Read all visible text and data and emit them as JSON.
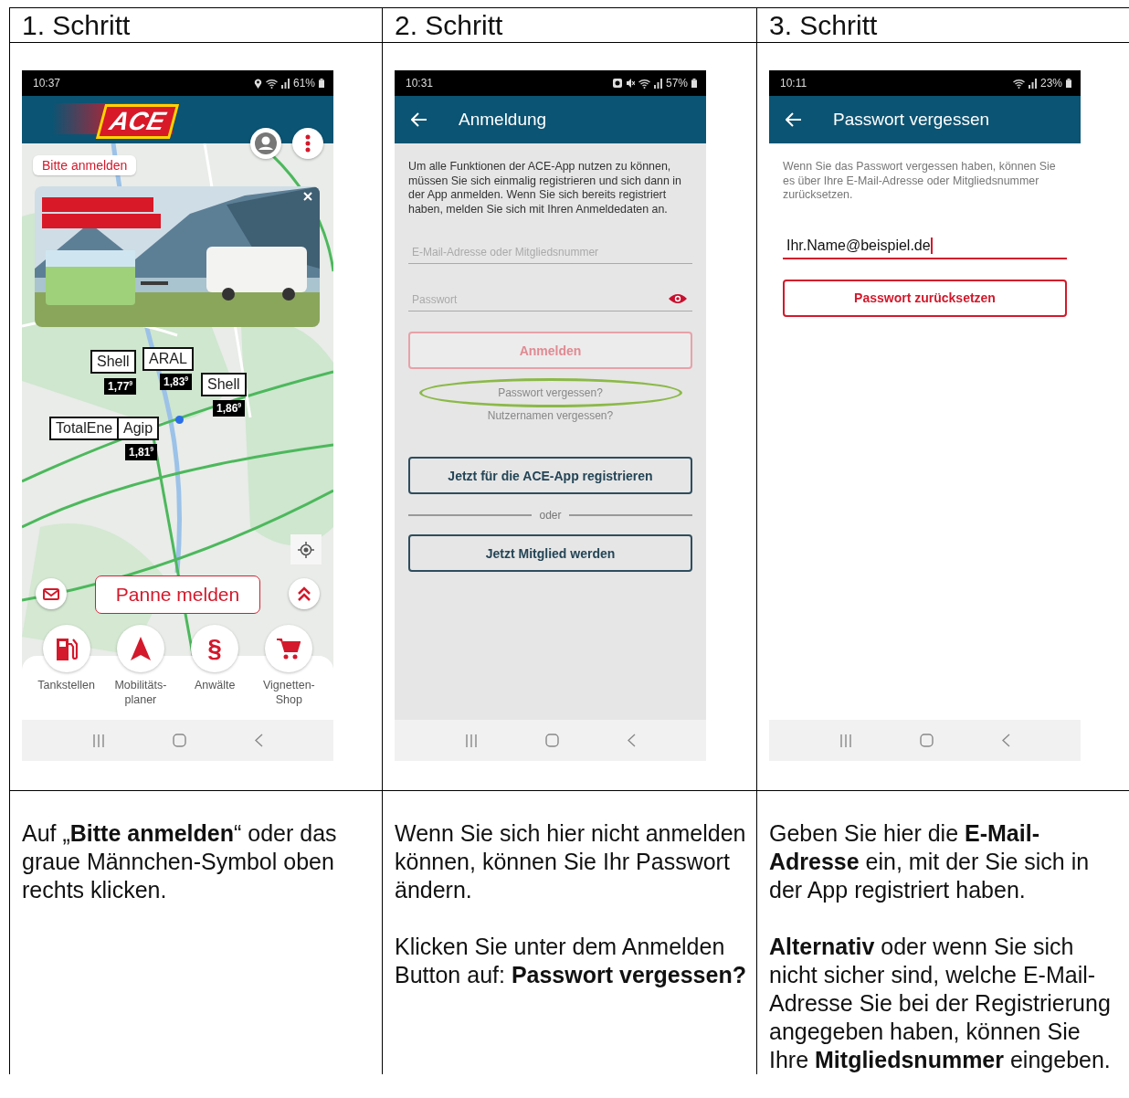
{
  "steps": [
    {
      "heading": "1. Schritt",
      "screen": {
        "kind": "home",
        "time": "10:37",
        "battery": "61%",
        "logo": "ACE",
        "login_chip": "Bitte anmelden",
        "markers": [
          {
            "brand": "Shell",
            "price": "1,77$^{9}$"
          },
          {
            "brand": "ARAL",
            "price": "1,83$^{9}$"
          },
          {
            "brand": "Shell",
            "price": "1,86$^{9}$"
          },
          {
            "brand": "TotalEne"
          },
          {
            "brand": "Agip",
            "price": "1,81$^{9}$"
          }
        ],
        "report_button": "Panne melden",
        "actions": [
          {
            "label": "Tankstellen"
          },
          {
            "label": "Mobilitäts-\nplaner"
          },
          {
            "label": "Anwälte",
            "symbol": "§"
          },
          {
            "label": "Vignetten-\nShop"
          }
        ]
      },
      "paragraphs": [
        "Auf „**Bitte anmelden**“ oder das graue Männchen-Symbol oben rechts klicken."
      ]
    },
    {
      "heading": "2. Schritt",
      "screen": {
        "kind": "login",
        "time": "10:31",
        "battery": "57%",
        "title": "Anmeldung",
        "intro": "Um alle Funktionen der ACE-App nutzen zu können, müssen Sie sich einmalig registrieren und sich dann in der App anmelden. Wenn Sie sich bereits registriert haben, melden Sie sich mit Ihren Anmeldedaten an.",
        "fields": [
          {
            "placeholder": "E-Mail-Adresse oder Mitgliedsnummer"
          },
          {
            "placeholder": "Passwort"
          }
        ],
        "login_button": {
          "label": "Anmelden",
          "disabled": true
        },
        "links": [
          {
            "label": "Passwort vergessen?",
            "highlighted": true
          },
          {
            "label": "Nutzernamen vergessen?",
            "highlighted": false
          }
        ],
        "register_button": "Jetzt für die ACE-App registrieren",
        "divider": "oder",
        "member_button": "Jetzt Mitglied werden"
      },
      "paragraphs": [
        "Wenn Sie sich hier nicht anmelden können, können Sie Ihr Passwort ändern.",
        "Klicken Sie unter dem Anmelden Button auf: **Passwort vergessen?**"
      ]
    },
    {
      "heading": "3. Schritt",
      "screen": {
        "kind": "forgot",
        "time": "10:11",
        "battery": "23%",
        "title": "Passwort vergessen",
        "intro": "Wenn Sie das Passwort vergessen haben, können Sie es über Ihre E-Mail-Adresse oder Mitgliedsnummer zurücksetzen.",
        "field": {
          "value": "Ihr.Name@beispiel.de",
          "focused": true
        },
        "reset_button": "Passwort zurücksetzen"
      },
      "paragraphs": [
        "Geben Sie hier die **E-Mail-Adresse** ein, mit der Sie sich in der App registriert haben.",
        "**Alternativ** oder wenn Sie sich nicht sicher sind, welche E-Mail-Adresse Sie bei der Registrierung angegeben haben, können Sie Ihre **Mitgliedsnummer** eingeben."
      ]
    }
  ]
}
